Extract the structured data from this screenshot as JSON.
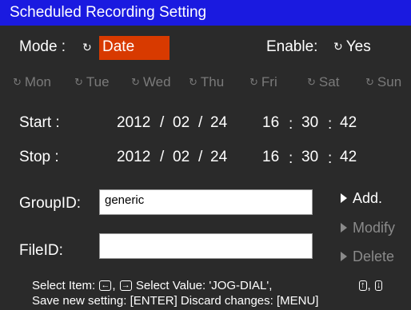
{
  "title": "Scheduled Recording Setting",
  "mode": {
    "label": "Mode :",
    "value": "Date"
  },
  "enable": {
    "label": "Enable:",
    "value": "Yes"
  },
  "days": [
    "Mon",
    "Tue",
    "Wed",
    "Thu",
    "Fri",
    "Sat",
    "Sun"
  ],
  "start": {
    "label": "Start :",
    "year": "2012",
    "month": "02",
    "day": "24",
    "hour": "16",
    "minute": "30",
    "second": "42"
  },
  "stop": {
    "label": "Stop :",
    "year": "2012",
    "month": "02",
    "day": "24",
    "hour": "16",
    "minute": "30",
    "second": "42"
  },
  "group": {
    "label": "GroupID:",
    "value": "generic"
  },
  "file": {
    "label": "FileID:",
    "value": ""
  },
  "buttons": {
    "add": "Add.",
    "modify": "Modify",
    "delete": "Delete"
  },
  "help": {
    "line1_a": "Select Item:",
    "line1_b": "Select Value: 'JOG-DIAL',",
    "line2": "Save new setting: [ENTER]   Discard changes: [MENU]",
    "key_left": "←",
    "key_right": "→",
    "key_up": "↑",
    "key_down": "↓"
  },
  "colors": {
    "titlebar": "#1a1ae0",
    "selected": "#d83a00",
    "background": "#2a2a2a"
  }
}
